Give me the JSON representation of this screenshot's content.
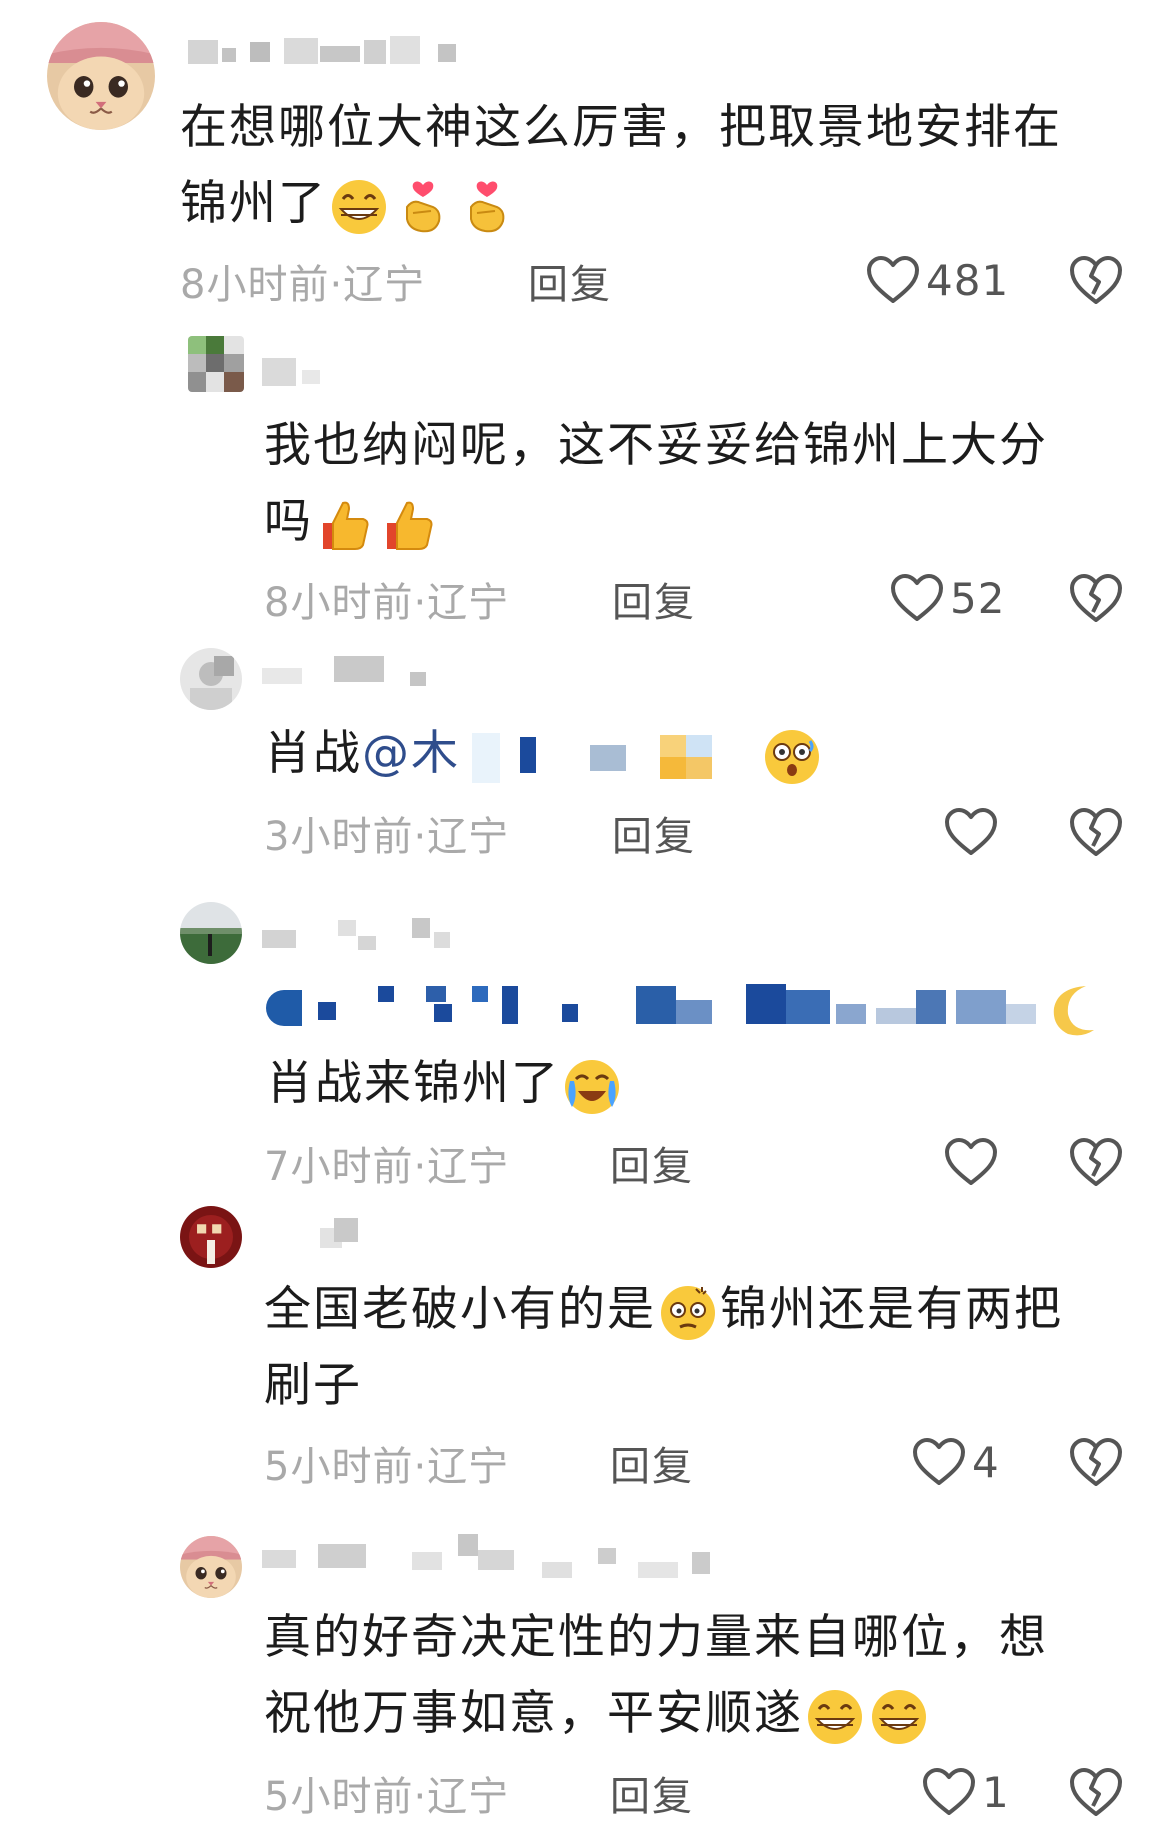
{
  "comments": [
    {
      "text_line1": "在想哪位大神这么厉害，把取景地安排在",
      "text_line2": "锦州了",
      "meta": "8小时前·辽宁",
      "reply": "回复",
      "likes": "481"
    },
    {
      "text_line1": "我也纳闷呢，这不妥妥给锦州上大分",
      "text_line2": "吗",
      "meta": "8小时前·辽宁",
      "reply": "回复",
      "likes": "52"
    },
    {
      "text_prefix": "肖战",
      "mention": "@木",
      "meta": "3小时前·辽宁",
      "reply": "回复",
      "likes": ""
    },
    {
      "text_line2": "肖战来锦州了",
      "meta": "7小时前·辽宁",
      "reply": "回复",
      "likes": ""
    },
    {
      "text_line1a": "全国老破小有的是",
      "text_line1b": "锦州还是有两把",
      "text_line2": "刷子",
      "meta": "5小时前·辽宁",
      "reply": "回复",
      "likes": "4"
    },
    {
      "text_line1": "真的好奇决定性的力量来自哪位，想",
      "text_line2": "祝他万事如意，平安顺遂",
      "meta": "5小时前·辽宁",
      "reply": "回复",
      "likes": "1"
    }
  ],
  "icons": {
    "like": "heart-outline-icon",
    "dislike": "broken-heart-icon"
  },
  "colors": {
    "meta": "#a9a9a9",
    "action": "#555555",
    "mention": "#2f4d8c"
  }
}
